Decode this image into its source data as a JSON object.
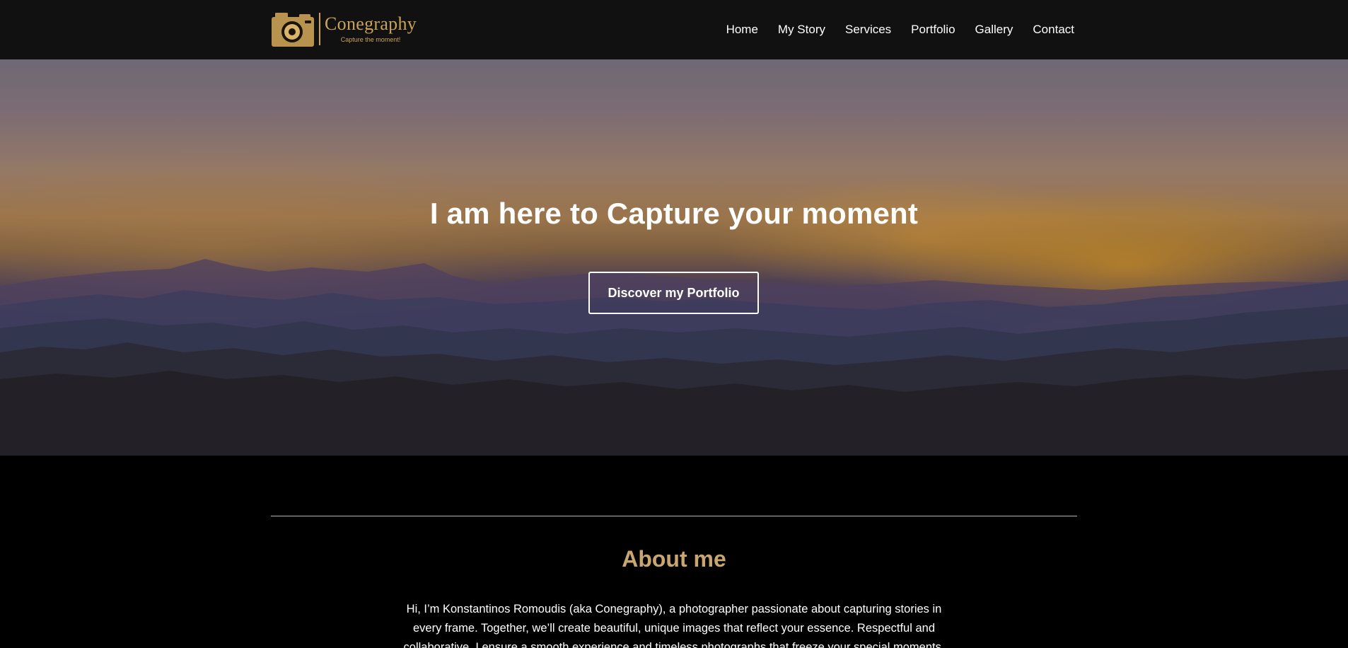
{
  "header": {
    "logo": {
      "name": "Conegraphy",
      "tagline": "Capture the moment!",
      "icon": "camera-icon"
    },
    "nav": [
      {
        "label": "Home"
      },
      {
        "label": "My Story"
      },
      {
        "label": "Services"
      },
      {
        "label": "Portfolio"
      },
      {
        "label": "Gallery"
      },
      {
        "label": "Contact"
      }
    ]
  },
  "hero": {
    "title": "I am here to Capture your moment",
    "button_label": "Discover my Portfolio"
  },
  "about": {
    "title": "About me",
    "text": "Hi, I’m Konstantinos Romoudis (aka Conegraphy), a photographer passionate about capturing stories in every frame. Together, we’ll create beautiful, unique images that reflect your essence. Respectful and collaborative, I ensure a smooth experience and timeless photographs that freeze your special moments."
  },
  "colors": {
    "header_bg": "#111111",
    "brand_gold": "#c9a35a",
    "about_title": "#c9a570",
    "page_bg": "#000000"
  }
}
